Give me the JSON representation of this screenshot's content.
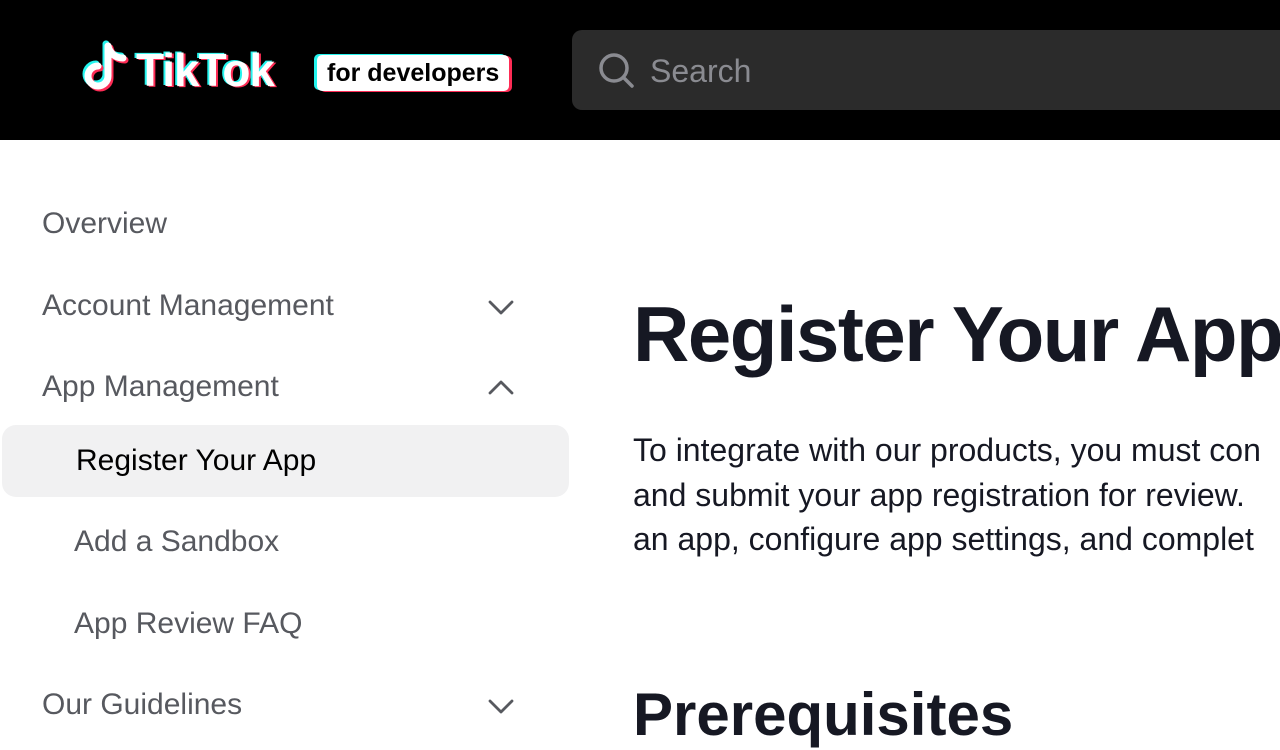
{
  "header": {
    "brand": "TikTok",
    "badge": "for developers",
    "search": {
      "placeholder": "Search",
      "value": ""
    }
  },
  "sidebar": {
    "items": [
      {
        "label": "Overview"
      },
      {
        "label": "Account Management",
        "icon": "chevron-down-icon"
      },
      {
        "label": "App Management",
        "icon": "chevron-up-icon"
      },
      {
        "label": "Register Your App",
        "active": true
      },
      {
        "label": "Add a Sandbox"
      },
      {
        "label": "App Review FAQ"
      },
      {
        "label": "Our Guidelines",
        "icon": "chevron-down-icon"
      }
    ]
  },
  "main": {
    "title": "Register Your App",
    "intro_lines": [
      "To integrate with our products, you must con",
      "and submit your app registration for review.",
      "an app, configure app settings, and complet"
    ],
    "section_heading": "Prerequisites"
  },
  "colors": {
    "header_bg": "#000000",
    "search_bg": "#2b2b2b",
    "active_item_bg": "#f1f1f2",
    "text_primary": "#161823",
    "text_secondary": "#57595f",
    "brand_cyan": "#25f4ee",
    "brand_red": "#fe2c55"
  }
}
